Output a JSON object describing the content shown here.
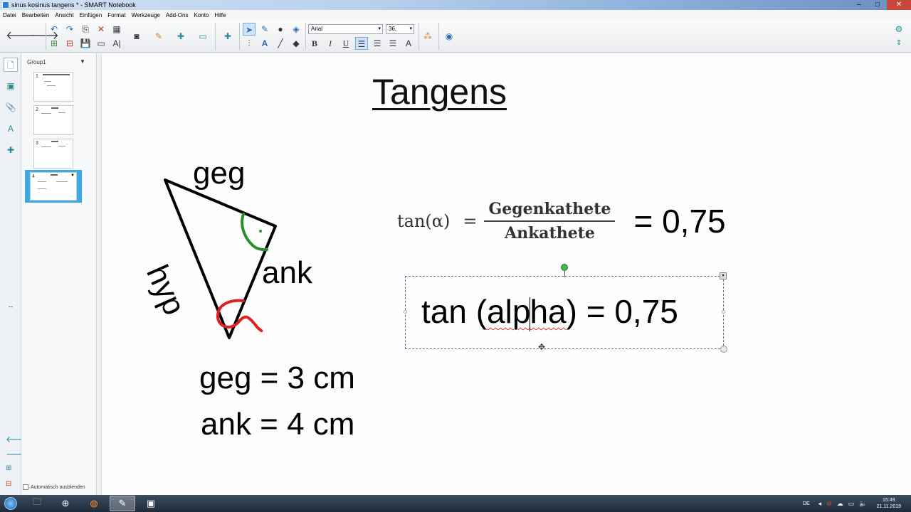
{
  "window": {
    "title": "sinus kosinus tangens * - SMART Notebook",
    "controls": [
      "–",
      "□",
      "✕"
    ]
  },
  "menu": [
    "Datei",
    "Bearbeiten",
    "Ansicht",
    "Einfügen",
    "Format",
    "Werkzeuge",
    "Add-Ons",
    "Konto",
    "Hilfe"
  ],
  "toolbar": {
    "font_name": "Arial",
    "font_size": "36,",
    "bold": "B",
    "italic": "I",
    "underline": "U"
  },
  "sidebar": {
    "group_label": "Group1",
    "pages": [
      "1",
      "2",
      "3",
      "4"
    ],
    "selected_page": 4,
    "auto_hide_label": "Automatisch ausblenden"
  },
  "canvas": {
    "title": "Tangens",
    "triangle_labels": {
      "opposite": "geg",
      "adjacent": "ank",
      "hypotenuse": "hyp"
    },
    "given_opposite": "geg = 3 cm",
    "given_adjacent": "ank = 4 cm",
    "formula": {
      "lhs": "tan(α)",
      "equals": "=",
      "numerator": "Gegenkathete",
      "denominator": "Ankathete",
      "result": "= 0,75"
    },
    "textbox": {
      "before_alpha": "tan (",
      "alpha_part1": "alp",
      "alpha_part2": "ha",
      "after_alpha": ") = 0,75"
    },
    "ink_colors": {
      "angle_marker": "#2a8f2a",
      "alpha_mark": "#e02020"
    }
  },
  "taskbar": {
    "language": "DE",
    "time": "15:49",
    "date": "21.11.2019"
  }
}
